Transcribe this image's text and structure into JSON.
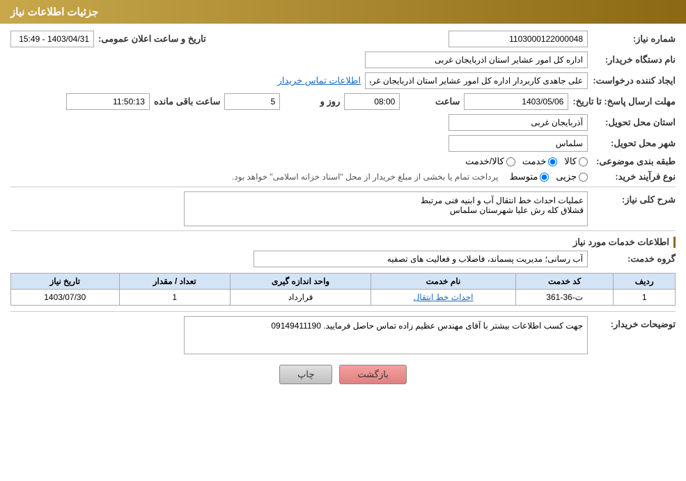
{
  "header": {
    "title": "جزئیات اطلاعات نیاز"
  },
  "fields": {
    "shomara_niaz_label": "شماره نیاز:",
    "shomara_niaz_value": "1103000122000048",
    "nam_dastgah_label": "نام دستگاه خریدار:",
    "nam_dastgah_value": "اداره کل امور عشایر استان اذربایجان غربی",
    "tarikh_label": "تاریخ و ساعت اعلان عمومی:",
    "tarikh_value": "1403/04/31 - 15:49",
    "ijad_konande_label": "ایجاد کننده درخواست:",
    "ijad_konande_value": "علی جاهدی کاربردار اداره کل امور عشایر استان اذربایجان غربی",
    "ettelaat_tamas_link": "اطلاعات تماس خریدار",
    "mohlat_ersal_label": "مهلت ارسال پاسخ: تا تاریخ:",
    "mohlat_date": "1403/05/06",
    "mohlat_saat_label": "ساعت",
    "mohlat_saat": "08:00",
    "mohlat_roz_label": "روز و",
    "mohlat_roz": "5",
    "mohlat_baqi_label": "ساعت باقی مانده",
    "mohlat_baqi": "11:50:13",
    "ostan_tahvil_label": "استان محل تحویل:",
    "ostan_tahvil_value": "آذربایجان غربی",
    "shahr_tahvil_label": "شهر محل تحویل:",
    "shahr_tahvil_value": "سلماس",
    "tabaqe_label": "طبقه بندی موضوعی:",
    "tabaqe_kala": "کالا",
    "tabaqe_khedmat": "خدمت",
    "tabaqe_kala_khedmat": "کالا/خدمت",
    "tabaqe_selected": "khedmat",
    "noue_farayand_label": "نوع فرآیند خرید:",
    "noue_jozi": "جزیی",
    "noue_motavasset": "متوسط",
    "noue_selected": "motavasset",
    "noue_note": "پرداخت تمام یا بخشی از مبلغ خریدار از محل \"اسناد خزانه اسلامی\" خواهد بود.",
    "sharh_label": "شرح کلی نیاز:",
    "sharh_value": "عملیات احداث خط انتقال آب و ابنیه فنی مرتبط\nقشلاق کله رش علیا شهرستان سلماس",
    "ettelaat_khadamat_label": "اطلاعات خدمات مورد نیاز",
    "grohe_khedmat_label": "گروه خدمت:",
    "grohe_khedmat_value": "آب رسانی؛ مدیریت پسماند، فاضلاب و فعالیت های تصفیه",
    "table": {
      "headers": [
        "ردیف",
        "کد خدمت",
        "نام خدمت",
        "واحد اندازه گیری",
        "تعداد / مقدار",
        "تاریخ نیاز"
      ],
      "rows": [
        {
          "radif": "1",
          "code": "ت-36-361",
          "name": "احداث خط انتقال",
          "vahed": "قرارداد",
          "tedad": "1",
          "tarikh": "1403/07/30"
        }
      ]
    },
    "tosihaat_label": "توضیحات خریدار:",
    "tosihaat_value": "جهت کسب اطلاعات بیشتر با آقای مهندس عظیم زاده تماس حاصل فرمایید. 09149411190"
  },
  "buttons": {
    "print_label": "چاپ",
    "back_label": "بازگشت"
  }
}
